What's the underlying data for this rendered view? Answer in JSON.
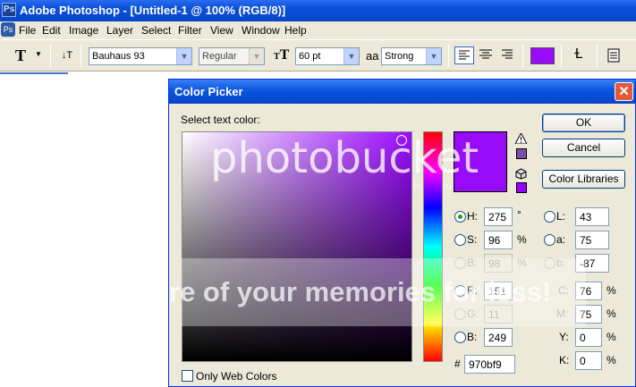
{
  "window": {
    "title": "Adobe Photoshop - [Untitled-1 @ 100% (RGB/8)]",
    "app_icon": "photoshop-app-icon"
  },
  "menubar": {
    "items": [
      "File",
      "Edit",
      "Image",
      "Layer",
      "Select",
      "Filter",
      "View",
      "Window",
      "Help"
    ]
  },
  "options": {
    "tool_glyph": "T",
    "orient_glyph": "↓T",
    "font_family": "Bauhaus 93",
    "font_style": "Regular",
    "size_glyph": "T",
    "font_size": "60 pt",
    "aa_glyph": "aa",
    "antialias": "Strong",
    "text_color": "#970bf9"
  },
  "dialog": {
    "title": "Color Picker",
    "close_glyph": "✕",
    "prompt": "Select text color:",
    "ok": "OK",
    "cancel": "Cancel",
    "libraries": "Color Libraries",
    "new_color": "#970bf9",
    "current_color": "#970bf9",
    "gamut_chip": "#7b4fa8",
    "websafe_chip": "#9900ff",
    "hsb": {
      "h_label": "H:",
      "h": "275",
      "h_unit": "°",
      "s_label": "S:",
      "s": "96",
      "s_unit": "%",
      "b_label": "B:",
      "b": "98",
      "b_unit": "%"
    },
    "rgb": {
      "r_label": "R:",
      "r": "151",
      "g_label": "G:",
      "g": "11",
      "b_label": "B:",
      "b": "249"
    },
    "hex_label": "#",
    "hex": "970bf9",
    "lab": {
      "l_label": "L:",
      "l": "43",
      "a_label": "a:",
      "a": "75",
      "b_label": "b:",
      "b": "-87"
    },
    "cmyk": {
      "c_label": "C:",
      "c": "76",
      "m_label": "M:",
      "m": "75",
      "y_label": "Y:",
      "y": "0",
      "k_label": "K:",
      "k": "0",
      "unit": "%"
    },
    "web_colors_label": "Only Web Colors"
  },
  "watermark": {
    "line1": "photobucket",
    "line2": "re of your memories for less!"
  }
}
